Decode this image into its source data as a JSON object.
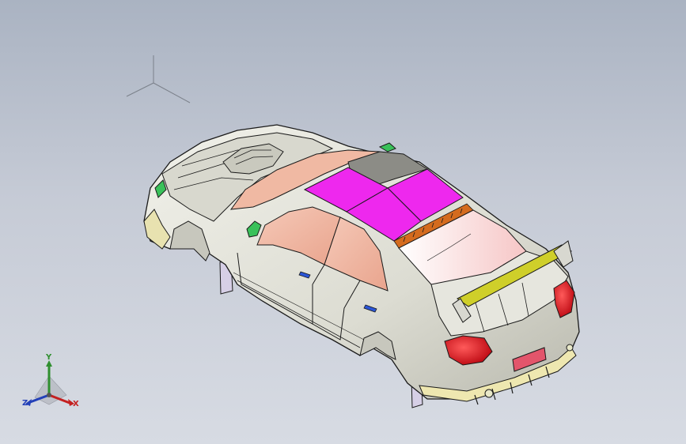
{
  "viewport": {
    "background_top": "#aab3c2",
    "background_bottom": "#d7dbe3"
  },
  "model": {
    "name": "rally-car-body",
    "colors": {
      "body": "#e4e4dc",
      "body_shadow": "#a9a9a0",
      "glass": "#f2b9a6",
      "roof_panel": "#ee28ee",
      "roof_stripe": "#d46b1e",
      "roof_dark": "#8c8c86",
      "spoiler": "#cfcf2a",
      "taillight": "#d9121b",
      "mudflap": "#d6cfe6",
      "mirror": "#39c15a",
      "door_handle": "#2a55d6",
      "license_plate": "#e3556b",
      "edges": "#1a1a1a"
    }
  },
  "triad": {
    "y_label": "Y",
    "x_label": "X",
    "z_label": "Z",
    "x_color": "#c42020",
    "y_color": "#2f8f2f",
    "z_color": "#2340b8"
  }
}
